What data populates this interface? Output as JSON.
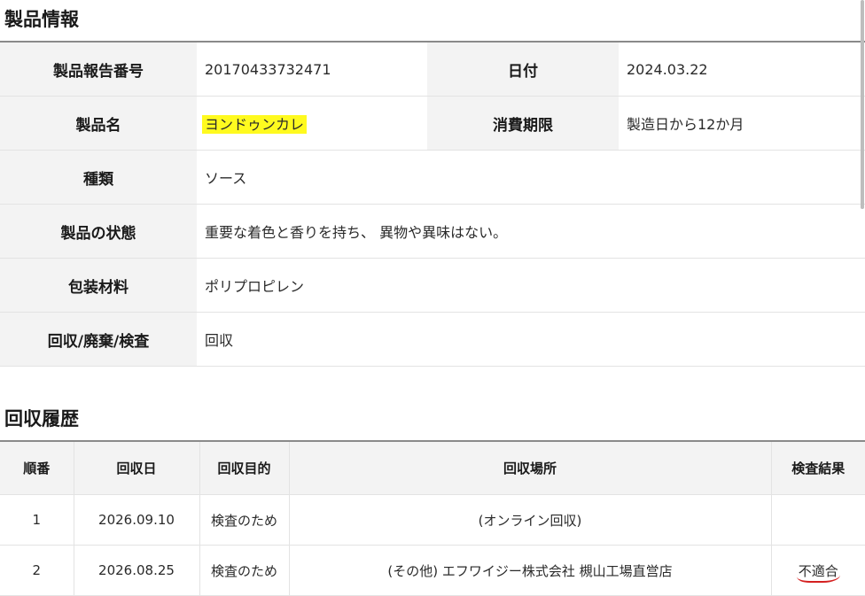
{
  "product_section_title": "製品情報",
  "product_info": {
    "report_no_label": "製品報告番号",
    "report_no": "20170433732471",
    "date_label": "日付",
    "date": "2024.03.22",
    "name_label": "製品名",
    "name": "ヨンドゥンカレ",
    "expiry_label": "消費期限",
    "expiry": "製造日から12か月",
    "type_label": "種類",
    "type": "ソース",
    "condition_label": "製品の状態",
    "condition": "重要な着色と香りを持ち、 異物や異味はない。",
    "packaging_label": "包装材料",
    "packaging": "ポリプロピレン",
    "action_label": "回収/廃棄/検査",
    "action": "回収"
  },
  "history_section_title": "回収履歴",
  "history": {
    "headers": [
      "順番",
      "回収日",
      "回収目的",
      "回収場所",
      "検査結果"
    ],
    "rows": [
      {
        "no": "1",
        "date": "2026.09.10",
        "purpose": "検査のため",
        "place": "(オンライン回収)",
        "result": ""
      },
      {
        "no": "2",
        "date": "2026.08.25",
        "purpose": "検査のため",
        "place": "(その他) エフワイジー株式会社 槻山工場直営店",
        "result": "不適合"
      }
    ]
  },
  "colors": {
    "highlight": "#fffa1f",
    "underline": "#d42020",
    "label_bg": "#f3f3f3"
  }
}
